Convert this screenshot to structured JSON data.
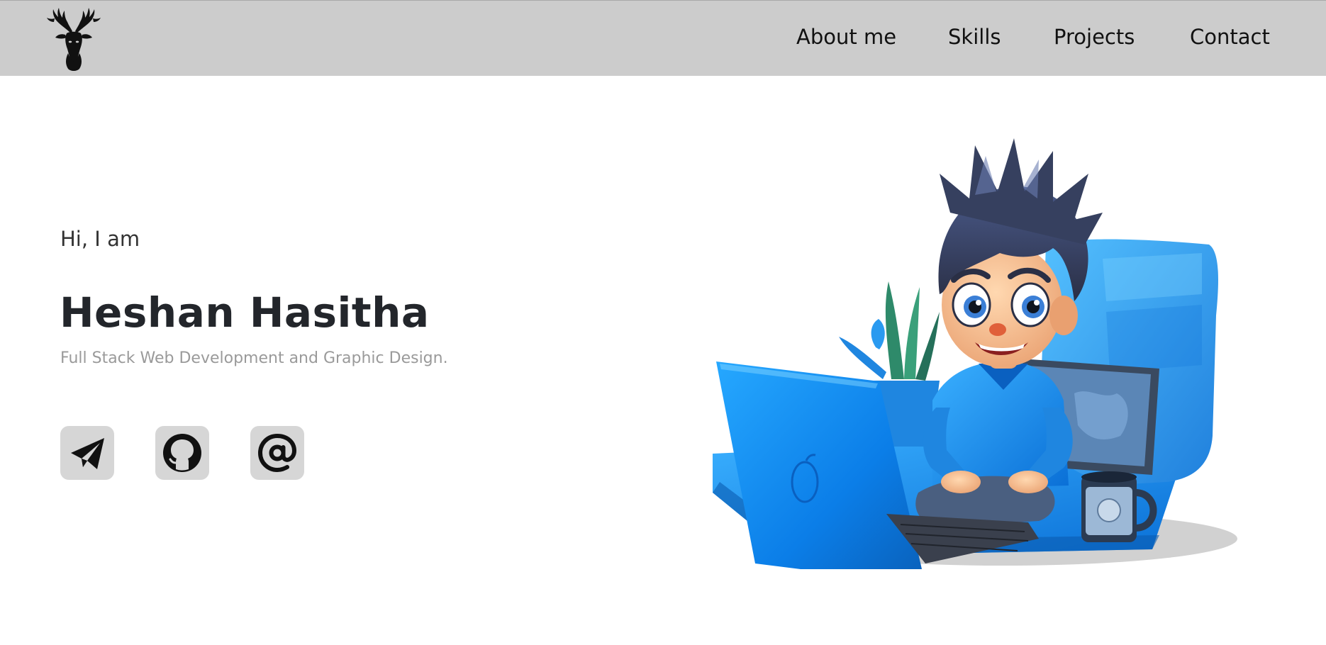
{
  "nav": {
    "logo_icon": "deer-head-logo-icon",
    "links": [
      "About me",
      "Skills",
      "Projects",
      "Contact"
    ]
  },
  "hero": {
    "greeting": "Hi, I am",
    "name": "Heshan Hasitha",
    "tagline": "Full Stack Web Development and Graphic Design."
  },
  "socials": {
    "icons": [
      "telegram-icon",
      "github-icon",
      "email-at-icon"
    ]
  },
  "colors": {
    "navbar_bg": "#cccccc",
    "social_button_bg": "#d6d6d6",
    "name_color": "#23262b",
    "tagline_color": "#9a9a9a",
    "accent_blue": "#1e88e5"
  }
}
